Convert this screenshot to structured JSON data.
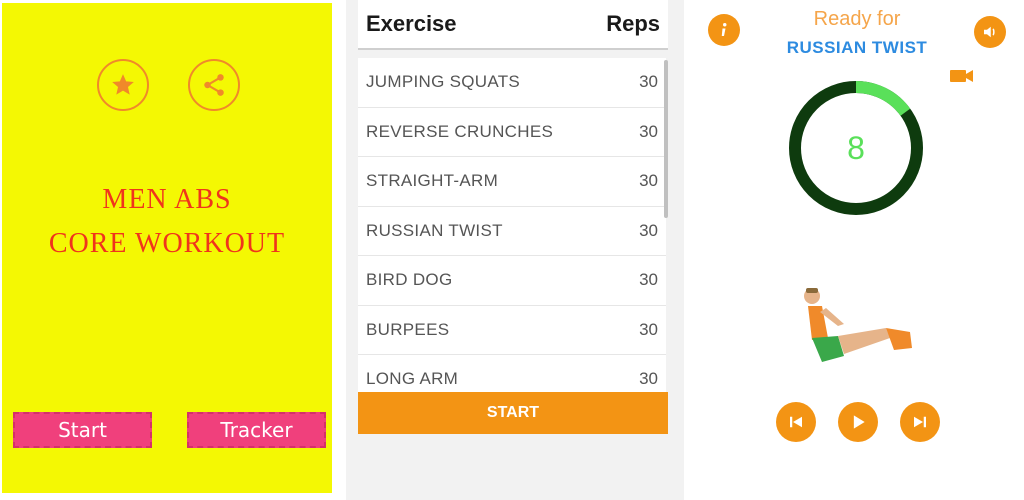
{
  "panel1": {
    "title_line1": "MEN ABS",
    "title_line2": "CORE WORKOUT",
    "start_label": "Start",
    "tracker_label": "Tracker",
    "background_color": "#f4f803"
  },
  "panel2": {
    "header_exercise": "Exercise",
    "header_reps": "Reps",
    "rows": [
      {
        "name": "JUMPING SQUATS",
        "reps": "30"
      },
      {
        "name": "REVERSE CRUNCHES",
        "reps": "30"
      },
      {
        "name": "STRAIGHT-ARM",
        "reps": "30"
      },
      {
        "name": "RUSSIAN TWIST",
        "reps": "30"
      },
      {
        "name": "BIRD DOG",
        "reps": "30"
      },
      {
        "name": "BURPEES",
        "reps": "30"
      },
      {
        "name": "LONG ARM",
        "reps": "30"
      }
    ],
    "start_label": "START",
    "accent_color": "#f39414"
  },
  "panel3": {
    "ready_text": "Ready for",
    "exercise_name": "RUSSIAN TWIST",
    "countdown": "8",
    "countdown_progress": 0.15,
    "icons": [
      "info-icon",
      "volume-icon",
      "video-icon",
      "skip-previous-icon",
      "play-icon",
      "skip-next-icon"
    ]
  }
}
